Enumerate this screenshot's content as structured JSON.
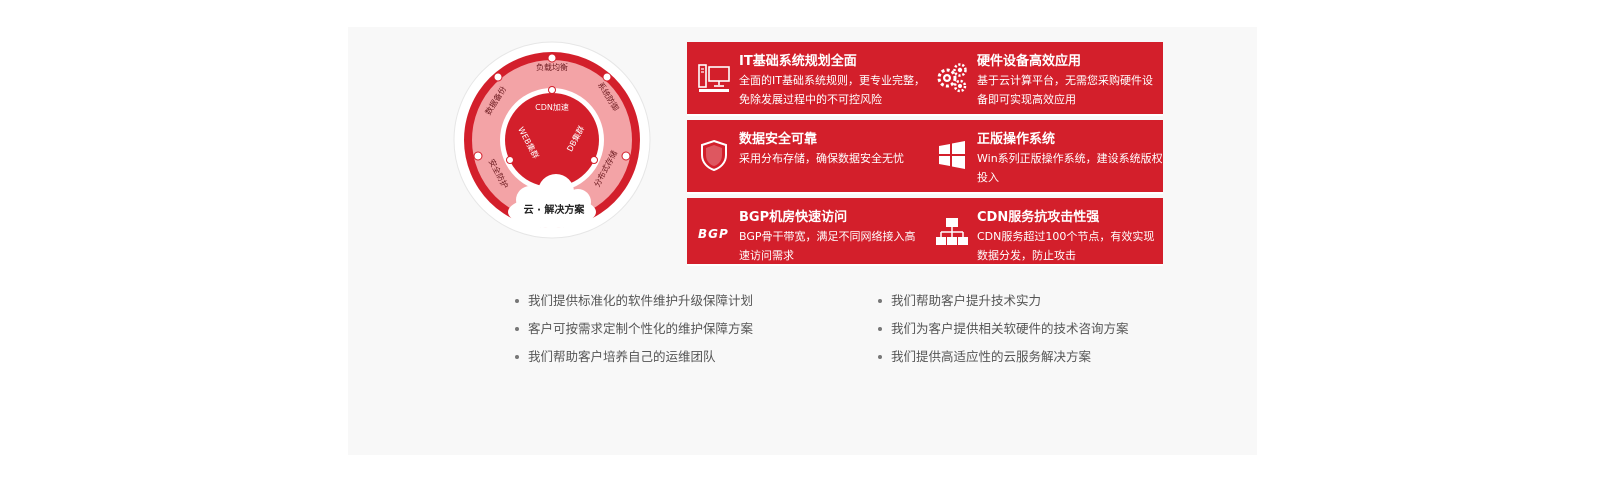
{
  "diagram": {
    "outer_labels": [
      "负载均衡",
      "数据备份",
      "系统防御",
      "安全防护",
      "分布式存储"
    ],
    "inner_labels": [
      "CDN加速",
      "WEB集群",
      "DB集群"
    ],
    "center_label": "云 · 解决方案"
  },
  "features": [
    {
      "icon": "computer-icon",
      "title": "IT基础系统规划全面",
      "desc": "全面的IT基础系统规则，更专业完整，免除发展过程中的不可控风险"
    },
    {
      "icon": "gears-icon",
      "title": "硬件设备高效应用",
      "desc": "基于云计算平台，无需您采购硬件设备即可实现高效应用"
    },
    {
      "icon": "shield-icon",
      "title": "数据安全可靠",
      "desc": "采用分布存储，确保数据安全无忧"
    },
    {
      "icon": "windows-icon",
      "title": "正版操作系统",
      "desc": "Win系列正版操作系统，建设系统版权投入"
    },
    {
      "icon": "bgp-logo-icon",
      "icon_text": "BGP",
      "title": "BGP机房快速访问",
      "desc": "BGP骨干带宽，满足不同网络接入高速访问需求"
    },
    {
      "icon": "network-icon",
      "title": "CDN服务抗攻击性强",
      "desc": "CDN服务超过100个节点，有效实现数据分发，防止攻击"
    }
  ],
  "bullets_left": [
    "我们提供标准化的软件维护升级保障计划",
    "客户可按需求定制个性化的维护保障方案",
    "我们帮助客户培养自己的运维团队"
  ],
  "bullets_right": [
    "我们帮助客户提升技术实力",
    "我们为客户提供相关软硬件的技术咨询方案",
    "我们提供高适应性的云服务解决方案"
  ],
  "colors": {
    "brand_red": "#d31f2b",
    "ring_pink": "#f3a3a6",
    "text_gray": "#555555"
  }
}
